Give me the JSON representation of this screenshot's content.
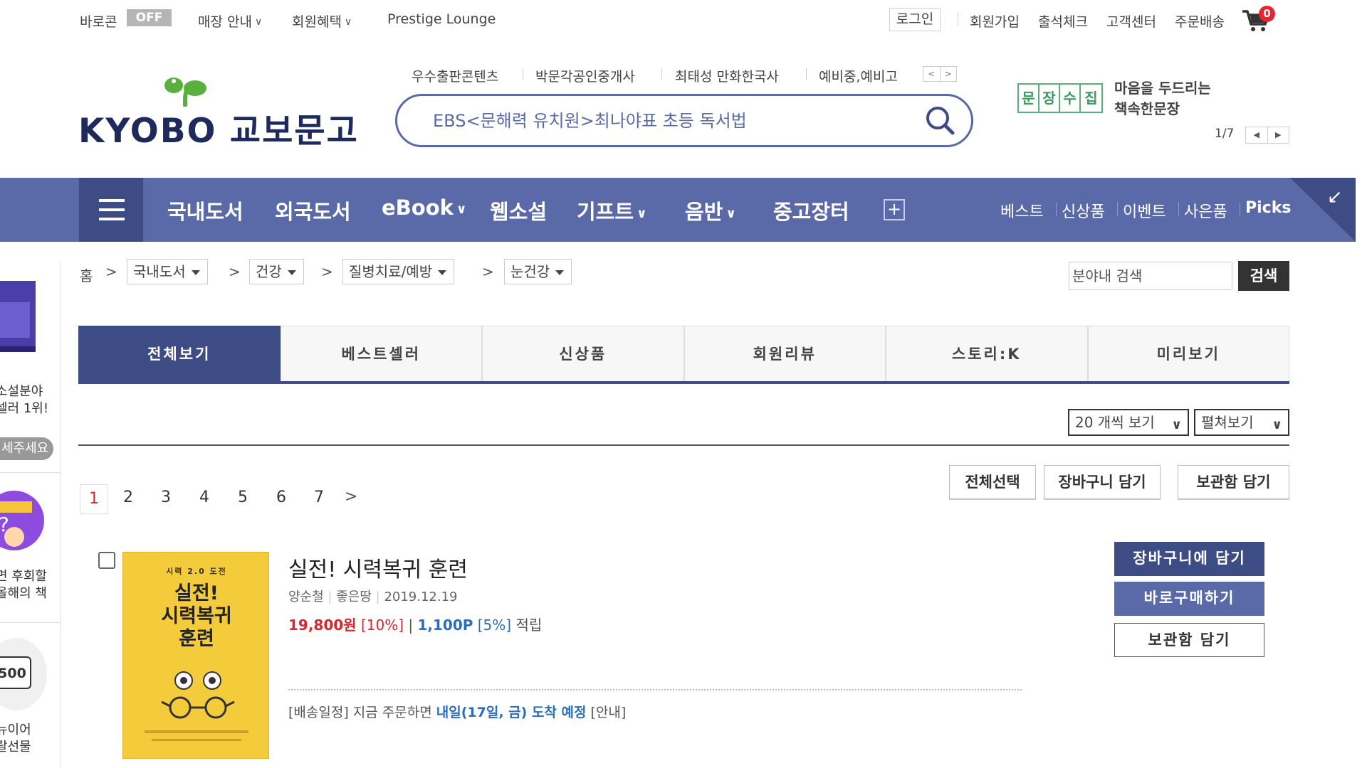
{
  "topbar": {
    "baroke_label": "바로콘",
    "baroke_state": "OFF",
    "store_info": "매장 안내",
    "member_benefits": "회원혜택",
    "prestige": "Prestige Lounge",
    "login": "로그인",
    "signup": "회원가입",
    "attendance": "출석체크",
    "customer_center": "고객센터",
    "order_delivery": "주문배송",
    "cart_count": "0"
  },
  "logo": {
    "text": "KYOBO 교보문고"
  },
  "keywords": [
    "우수출판콘텐츠",
    "박문각공인중개사",
    "최태성 만화한국사",
    "예비중,예비고"
  ],
  "search": {
    "placeholder": "EBS<문해력 유치원>최나야표 초등 독서법"
  },
  "promo": {
    "stamp_chars": [
      "문",
      "장",
      "수",
      "집"
    ],
    "line1": "마음을 두드리는",
    "line2": "책속한문장",
    "pager": "1/7"
  },
  "gnb": {
    "items": [
      "국내도서",
      "외국도서",
      "eBook",
      "웹소설",
      "기프트",
      "음반",
      "중고장터"
    ],
    "right": [
      "베스트",
      "신상품",
      "이벤트",
      "사은품",
      "Picks"
    ]
  },
  "sidebar": {
    "text1a": "소설분야",
    "text1b": "셀러 1위!",
    "button": "세주세요",
    "text2a": "면 후회할",
    "text2b": "올해의 책",
    "text3a": "뉴이어",
    "text3b": "랄선물",
    "coin_label": "500"
  },
  "breadcrumb": {
    "home": "홈",
    "levels": [
      "국내도서",
      "건강",
      "질병치료/예방",
      "눈건강"
    ],
    "search_placeholder": "분야내 검색",
    "search_button": "검색"
  },
  "tabs": [
    "전체보기",
    "베스트셀러",
    "신상품",
    "회원리뷰",
    "스토리:K",
    "미리보기"
  ],
  "list_controls": {
    "per_page": "20 개씩 보기",
    "view_mode": "펼쳐보기",
    "select_all": "전체선택",
    "add_cart": "장바구니 담기",
    "add_wishlist": "보관함 담기"
  },
  "pagination": {
    "current": "1",
    "pages": [
      "2",
      "3",
      "4",
      "5",
      "6",
      "7"
    ]
  },
  "product": {
    "cover_top": "시력 2.0 도전",
    "cover_title_1": "실전!",
    "cover_title_2": "시력복귀",
    "cover_title_3": "훈련",
    "title": "실전! 시력복귀 훈련",
    "author": "양순철",
    "publisher": "좋은땅",
    "date": "2019.12.19",
    "price": "19,800원",
    "discount": "[10%]",
    "points": "1,100P",
    "point_rate": "[5%]",
    "point_suffix": "적립",
    "ship_prefix": "[배송일정] 지금 주문하면",
    "ship_date": "내일(17일, 금) 도착 예정",
    "ship_suffix": "[안내]",
    "btn_cart": "장바구니에 담기",
    "btn_buy": "바로구매하기",
    "btn_wish": "보관함 담기"
  },
  "colors": {
    "brand": "#5a6aa8",
    "brand_dark": "#3e4c86",
    "price_red": "#d9262f",
    "point_blue": "#2a6ebb"
  }
}
